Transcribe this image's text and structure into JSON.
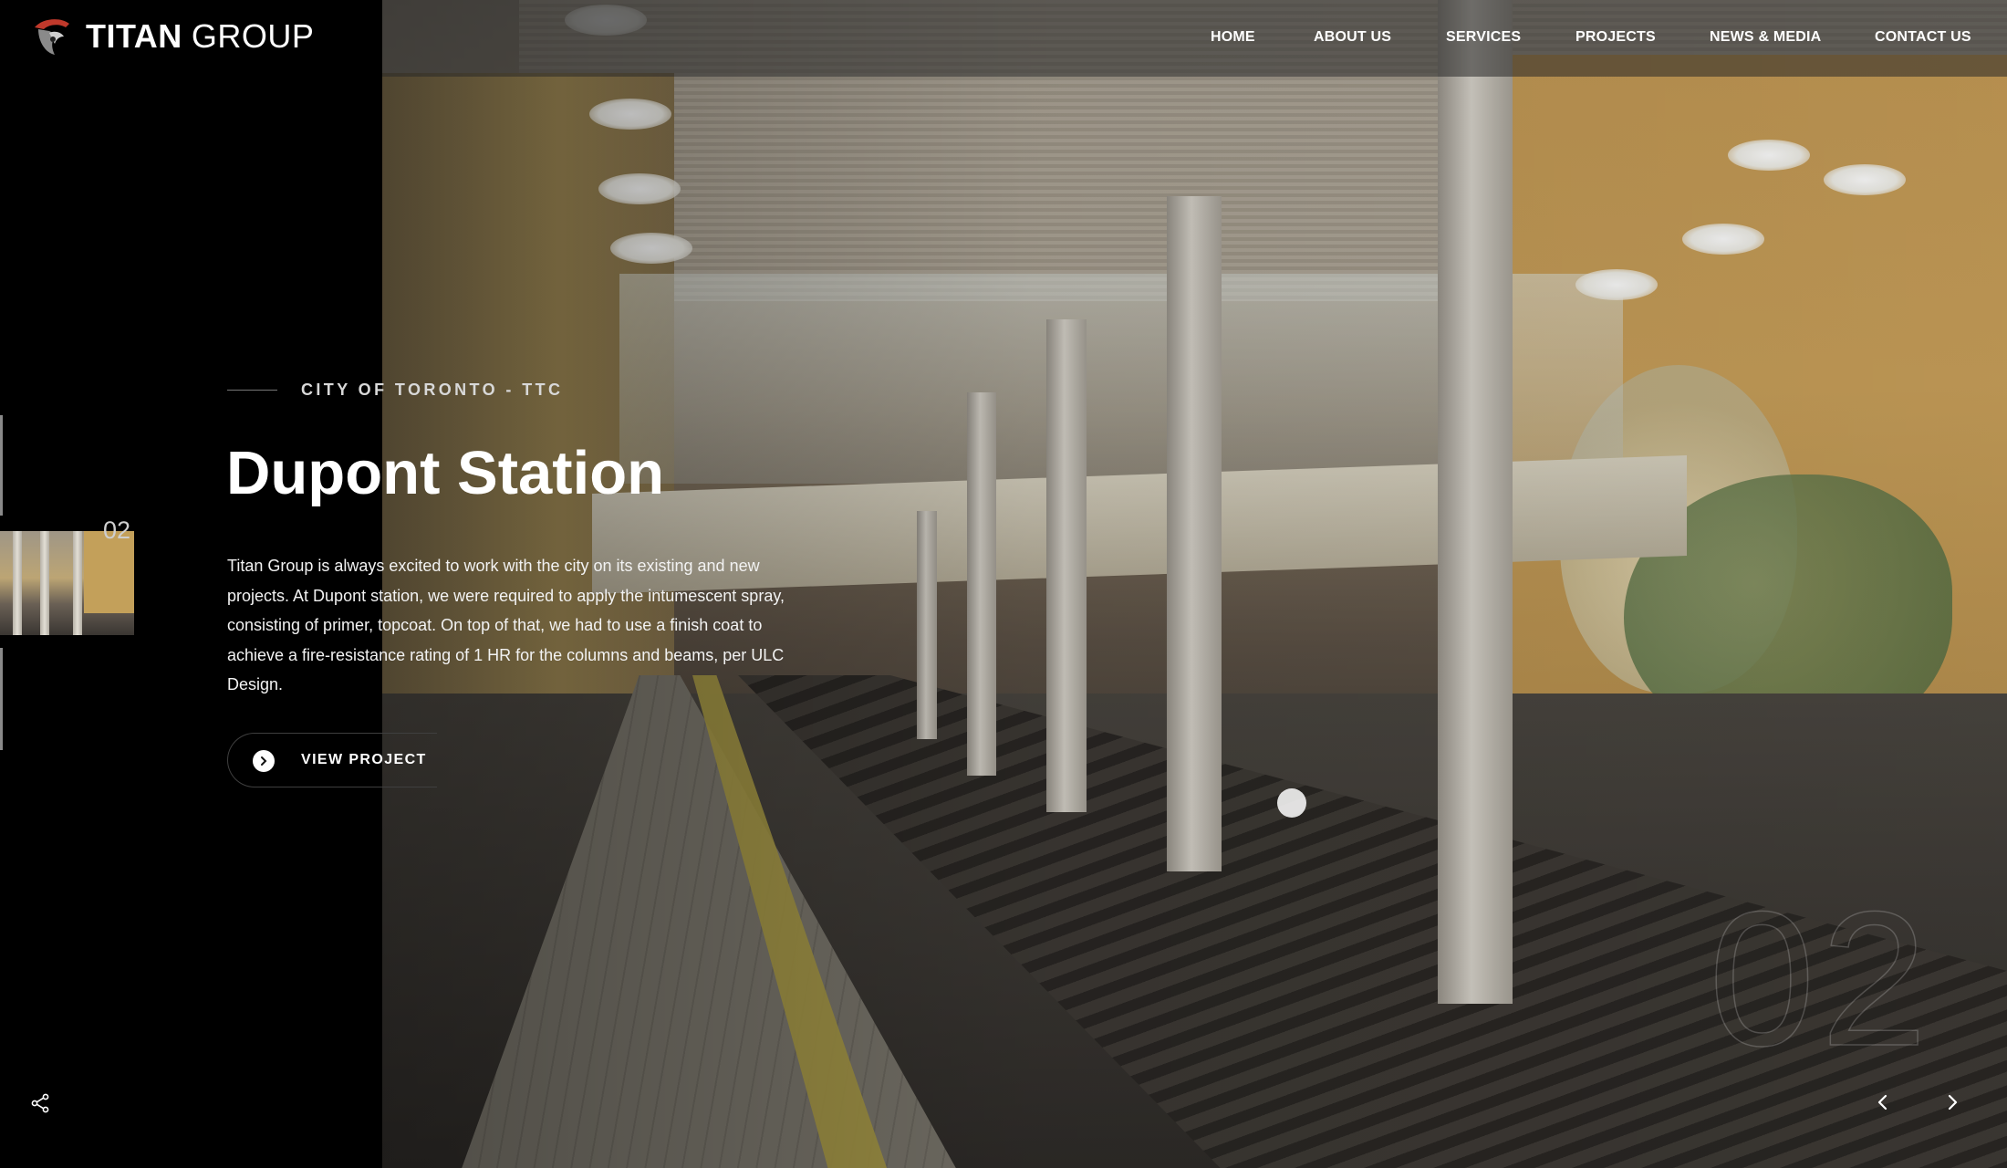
{
  "brand": {
    "name_bold": "TITAN",
    "name_light": "GROUP",
    "logo_icon": "titan-helmet-logo-icon"
  },
  "nav": {
    "items": [
      {
        "label": "HOME"
      },
      {
        "label": "ABOUT US"
      },
      {
        "label": "SERVICES"
      },
      {
        "label": "PROJECTS"
      },
      {
        "label": "NEWS & MEDIA"
      },
      {
        "label": "CONTACT US"
      }
    ]
  },
  "slider": {
    "current_thumb_number": "02",
    "big_number": "02"
  },
  "project": {
    "client": "CITY OF TORONTO - TTC",
    "title": "Dupont Station",
    "description": "Titan Group is always excited to work with the city on its existing and new projects. At Dupont station, we were required to apply the intumescent spray, consisting of primer, topcoat. On top of that, we had to use a finish coat to achieve a fire-resistance rating of 1 HR for the columns and beams, per ULC Design.",
    "cta_label": "VIEW PROJECT",
    "cta_icon": "chevron-right-circle-icon"
  },
  "controls": {
    "share_icon": "share-icon",
    "prev_icon": "chevron-left-icon",
    "next_icon": "chevron-right-icon"
  },
  "colors": {
    "background": "#000000",
    "text": "#ffffff",
    "topbar_overlay": "rgba(40,40,40,0.55)"
  }
}
